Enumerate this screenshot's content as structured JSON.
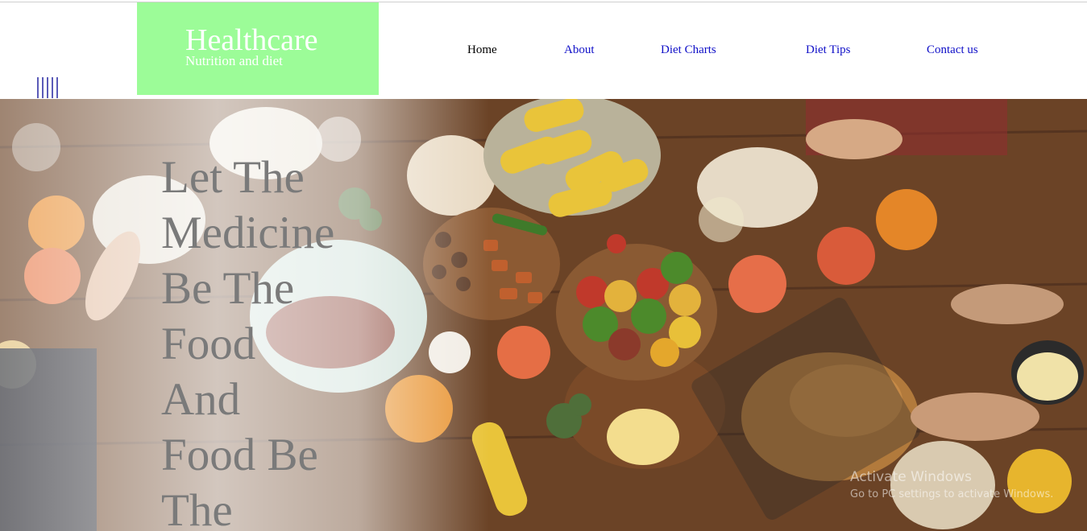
{
  "logo": {
    "title": "Healthcare",
    "subtitle": "Nutrition and diet"
  },
  "nav": {
    "items": [
      {
        "label": "Home"
      },
      {
        "label": "About"
      },
      {
        "label": "Diet Charts"
      },
      {
        "label": "Diet Tips"
      },
      {
        "label": "Contact us"
      }
    ]
  },
  "menu_icon": "hamburger-icon",
  "hero": {
    "lines": [
      "Let The",
      "Medicine",
      "Be The",
      "Food",
      "And",
      "Food Be",
      "The"
    ]
  },
  "windows_notice": {
    "title": "Activate Windows",
    "subtitle": "Go to PC settings to activate Windows."
  },
  "colors": {
    "logo_bg": "#9cfc98",
    "nav_link": "#1010c8",
    "nav_active": "#000000",
    "hero_text": "#7a7a7a"
  }
}
